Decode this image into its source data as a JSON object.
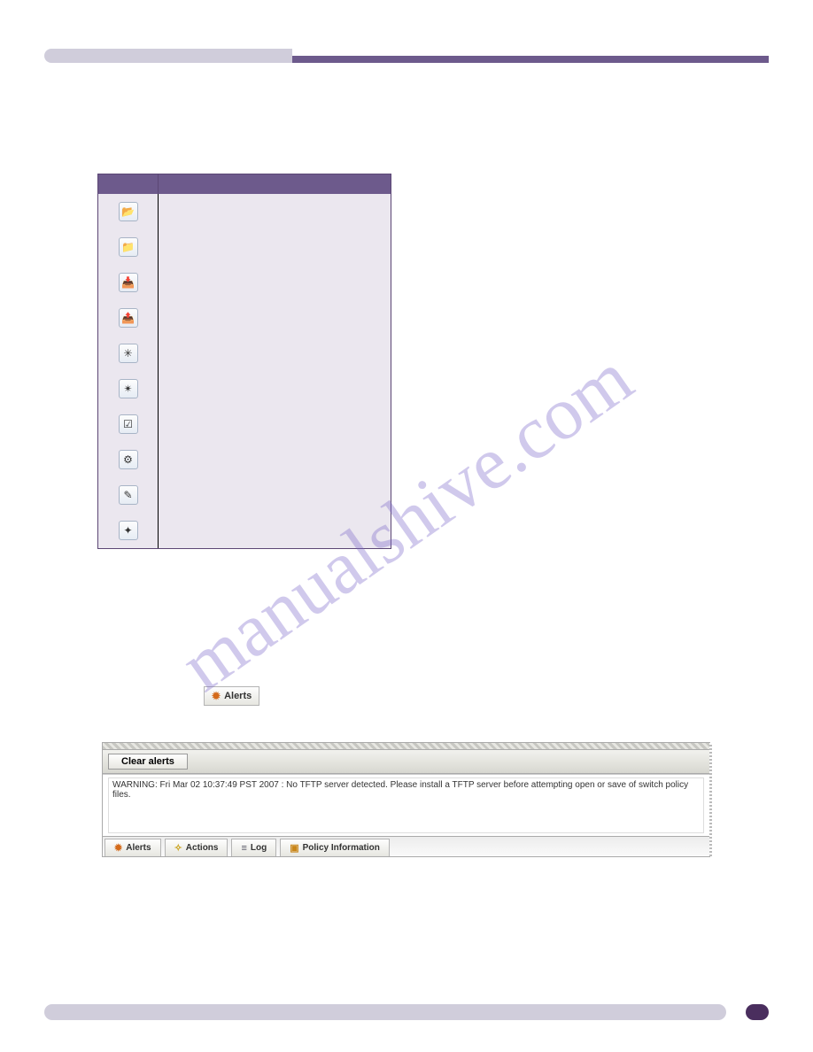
{
  "watermark": "manualshive.com",
  "toolbar_icons": [
    {
      "name": "open-switch-icon",
      "glyph": "📂"
    },
    {
      "name": "close-switch-icon",
      "glyph": "📁"
    },
    {
      "name": "import-icon",
      "glyph": "📥"
    },
    {
      "name": "export-icon",
      "glyph": "📤"
    },
    {
      "name": "policy-edit-icon",
      "glyph": "✳"
    },
    {
      "name": "policy-apply-icon",
      "glyph": "✴"
    },
    {
      "name": "verify-icon",
      "glyph": "☑"
    },
    {
      "name": "config-icon",
      "glyph": "⚙"
    },
    {
      "name": "wizard-icon",
      "glyph": "✎"
    },
    {
      "name": "refresh-icon",
      "glyph": "✦"
    }
  ],
  "alerts_tab_label": "Alerts",
  "alerts_panel": {
    "clear_button": "Clear alerts",
    "message": "WARNING: Fri Mar 02 10:37:49 PST 2007 : No TFTP server detected. Please install a TFTP server before attempting open or save of switch policy files.",
    "tabs": {
      "alerts": "Alerts",
      "actions": "Actions",
      "log": "Log",
      "policy": "Policy Information"
    }
  }
}
